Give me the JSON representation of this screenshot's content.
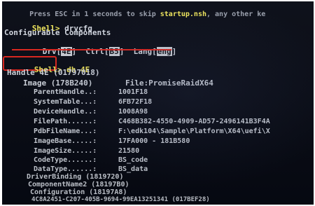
{
  "console": {
    "prompt": "Shell>",
    "top_line": {
      "prefix": "Press ESC in 1 seconds to skip ",
      "script": "startup.nsh",
      "suffix": ", any other ke"
    },
    "cmd1": "drvcfg",
    "configurable_title": "Configurable Components",
    "components": {
      "drv_label": "Drv[",
      "drv_value": "4E",
      "drv_close": "]",
      "ctrl_label": "Ctrl[",
      "ctrl_value": "B5",
      "ctrl_close": "]",
      "lang_label": "Lang[",
      "lang_value": "eng",
      "lang_close": "]"
    },
    "cmd2": "dh 4E",
    "handle_line": "Handle 4E (01797018)",
    "image_line": "Image (178B240)",
    "file_line": "File:PromiseRaidX64",
    "fields": [
      {
        "label": "ParentHandle..:",
        "value": "1001F18"
      },
      {
        "label": "SystemTable...:",
        "value": "6FB72F18"
      },
      {
        "label": "DeviceHandle..:",
        "value": "1008A98"
      },
      {
        "label": "FilePath......:",
        "value": "C468B382-4550-4909-AD57-2496141B3F4A"
      },
      {
        "label": "PdbFileName...:",
        "value": "F:\\edk104\\Sample\\Platform\\X64\\uefi\\X"
      },
      {
        "label": "ImageBase.....:",
        "value": "17FA000 - 181B580"
      },
      {
        "label": "ImageSize.....:",
        "value": "21580"
      },
      {
        "label": "CodeType......:",
        "value": "BS_code"
      },
      {
        "label": "DataType......:",
        "value": "BS_data"
      }
    ],
    "protocols": [
      "DriverBinding (1819720)",
      "ComponentName2 (18197B0)",
      "Configuration (18197A8)",
      "4C8A2451-C207-405B-9694-99EA13251341 (017BEF28)"
    ]
  }
}
